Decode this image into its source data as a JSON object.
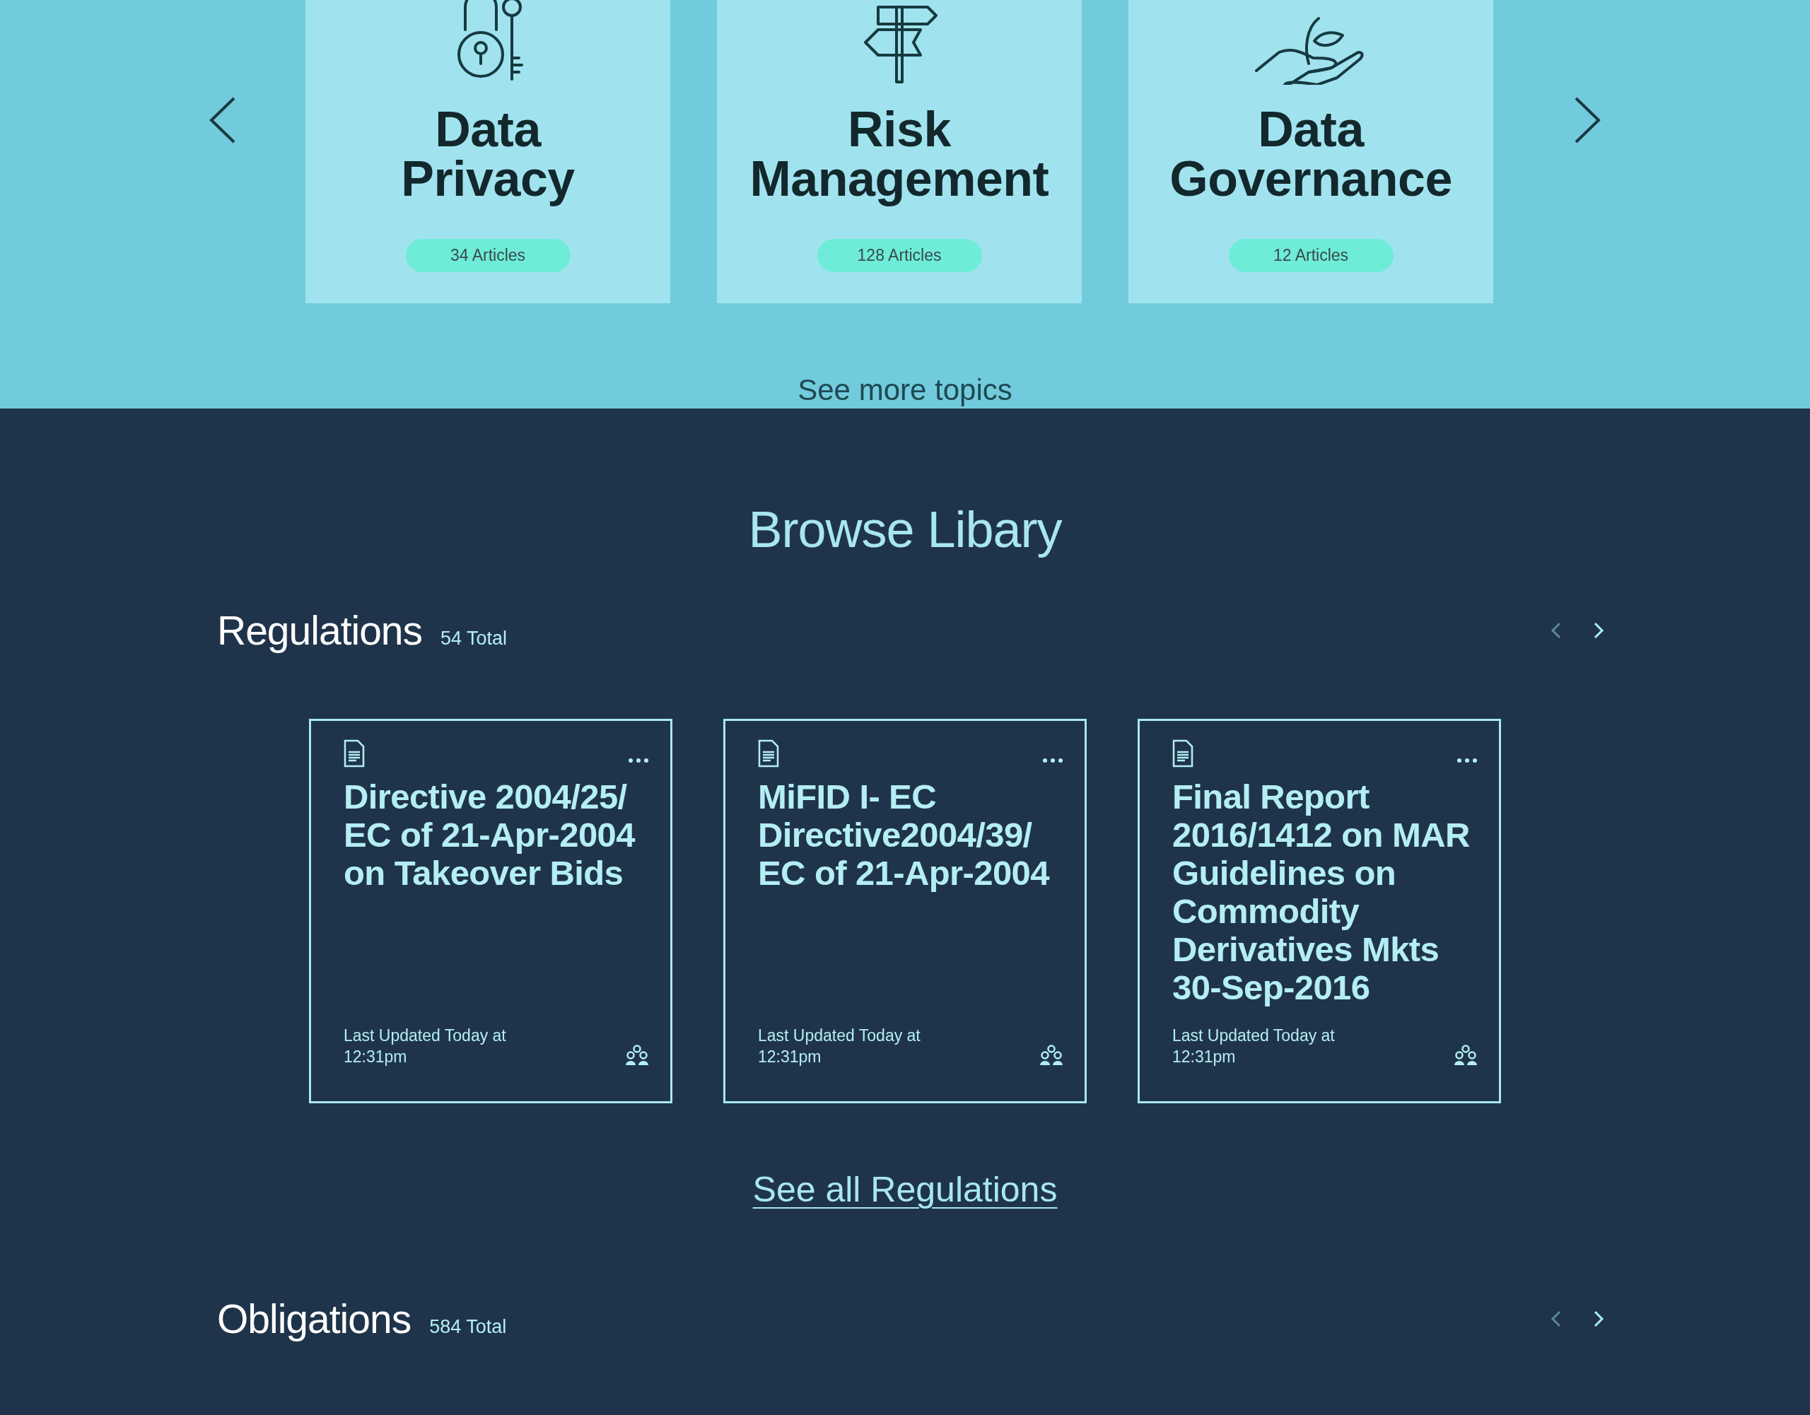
{
  "topics": {
    "cards": [
      {
        "title": "Data Privacy",
        "count": "34 Articles"
      },
      {
        "title": "Risk Management",
        "count": "128 Articles"
      },
      {
        "title": "Data Governance",
        "count": "12 Articles"
      }
    ],
    "see_more": "See more topics"
  },
  "library": {
    "title": "Browse Libary",
    "sections": [
      {
        "heading": "Regulations",
        "total": "54 Total",
        "nav": [
          {
            "kind": "prev",
            "disabled": true
          },
          {
            "kind": "next",
            "disabled": false
          }
        ],
        "cards": [
          {
            "title": "Directive 2004/25/ EC of 21-Apr-2004 on Takeover Bids",
            "updated": "Last Updated Today at 12:31pm"
          },
          {
            "title": "MiFID I- EC Directive2004/39/ EC of 21-Apr-2004",
            "updated": "Last Updated Today at 12:31pm"
          },
          {
            "title": "Final Report 2016/1412 on MAR Guidelines on Commodity Derivatives Mkts 30-Sep-2016",
            "updated": "Last Updated Today at 12:31pm"
          }
        ],
        "see_all": "See all Regulations"
      },
      {
        "heading": "Obligations",
        "total": "584 Total",
        "nav": [
          {
            "kind": "prev",
            "disabled": true
          },
          {
            "kind": "next",
            "disabled": false
          }
        ]
      }
    ]
  }
}
